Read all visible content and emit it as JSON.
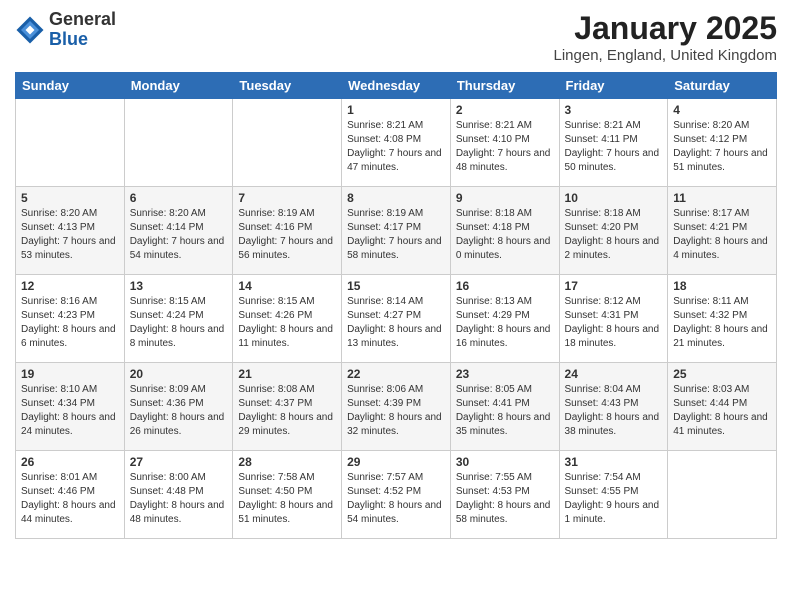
{
  "header": {
    "logo_general": "General",
    "logo_blue": "Blue",
    "month_title": "January 2025",
    "location": "Lingen, England, United Kingdom"
  },
  "weekdays": [
    "Sunday",
    "Monday",
    "Tuesday",
    "Wednesday",
    "Thursday",
    "Friday",
    "Saturday"
  ],
  "weeks": [
    [
      {
        "day": "",
        "sunrise": "",
        "sunset": "",
        "daylight": ""
      },
      {
        "day": "",
        "sunrise": "",
        "sunset": "",
        "daylight": ""
      },
      {
        "day": "",
        "sunrise": "",
        "sunset": "",
        "daylight": ""
      },
      {
        "day": "1",
        "sunrise": "Sunrise: 8:21 AM",
        "sunset": "Sunset: 4:08 PM",
        "daylight": "Daylight: 7 hours and 47 minutes."
      },
      {
        "day": "2",
        "sunrise": "Sunrise: 8:21 AM",
        "sunset": "Sunset: 4:10 PM",
        "daylight": "Daylight: 7 hours and 48 minutes."
      },
      {
        "day": "3",
        "sunrise": "Sunrise: 8:21 AM",
        "sunset": "Sunset: 4:11 PM",
        "daylight": "Daylight: 7 hours and 50 minutes."
      },
      {
        "day": "4",
        "sunrise": "Sunrise: 8:20 AM",
        "sunset": "Sunset: 4:12 PM",
        "daylight": "Daylight: 7 hours and 51 minutes."
      }
    ],
    [
      {
        "day": "5",
        "sunrise": "Sunrise: 8:20 AM",
        "sunset": "Sunset: 4:13 PM",
        "daylight": "Daylight: 7 hours and 53 minutes."
      },
      {
        "day": "6",
        "sunrise": "Sunrise: 8:20 AM",
        "sunset": "Sunset: 4:14 PM",
        "daylight": "Daylight: 7 hours and 54 minutes."
      },
      {
        "day": "7",
        "sunrise": "Sunrise: 8:19 AM",
        "sunset": "Sunset: 4:16 PM",
        "daylight": "Daylight: 7 hours and 56 minutes."
      },
      {
        "day": "8",
        "sunrise": "Sunrise: 8:19 AM",
        "sunset": "Sunset: 4:17 PM",
        "daylight": "Daylight: 7 hours and 58 minutes."
      },
      {
        "day": "9",
        "sunrise": "Sunrise: 8:18 AM",
        "sunset": "Sunset: 4:18 PM",
        "daylight": "Daylight: 8 hours and 0 minutes."
      },
      {
        "day": "10",
        "sunrise": "Sunrise: 8:18 AM",
        "sunset": "Sunset: 4:20 PM",
        "daylight": "Daylight: 8 hours and 2 minutes."
      },
      {
        "day": "11",
        "sunrise": "Sunrise: 8:17 AM",
        "sunset": "Sunset: 4:21 PM",
        "daylight": "Daylight: 8 hours and 4 minutes."
      }
    ],
    [
      {
        "day": "12",
        "sunrise": "Sunrise: 8:16 AM",
        "sunset": "Sunset: 4:23 PM",
        "daylight": "Daylight: 8 hours and 6 minutes."
      },
      {
        "day": "13",
        "sunrise": "Sunrise: 8:15 AM",
        "sunset": "Sunset: 4:24 PM",
        "daylight": "Daylight: 8 hours and 8 minutes."
      },
      {
        "day": "14",
        "sunrise": "Sunrise: 8:15 AM",
        "sunset": "Sunset: 4:26 PM",
        "daylight": "Daylight: 8 hours and 11 minutes."
      },
      {
        "day": "15",
        "sunrise": "Sunrise: 8:14 AM",
        "sunset": "Sunset: 4:27 PM",
        "daylight": "Daylight: 8 hours and 13 minutes."
      },
      {
        "day": "16",
        "sunrise": "Sunrise: 8:13 AM",
        "sunset": "Sunset: 4:29 PM",
        "daylight": "Daylight: 8 hours and 16 minutes."
      },
      {
        "day": "17",
        "sunrise": "Sunrise: 8:12 AM",
        "sunset": "Sunset: 4:31 PM",
        "daylight": "Daylight: 8 hours and 18 minutes."
      },
      {
        "day": "18",
        "sunrise": "Sunrise: 8:11 AM",
        "sunset": "Sunset: 4:32 PM",
        "daylight": "Daylight: 8 hours and 21 minutes."
      }
    ],
    [
      {
        "day": "19",
        "sunrise": "Sunrise: 8:10 AM",
        "sunset": "Sunset: 4:34 PM",
        "daylight": "Daylight: 8 hours and 24 minutes."
      },
      {
        "day": "20",
        "sunrise": "Sunrise: 8:09 AM",
        "sunset": "Sunset: 4:36 PM",
        "daylight": "Daylight: 8 hours and 26 minutes."
      },
      {
        "day": "21",
        "sunrise": "Sunrise: 8:08 AM",
        "sunset": "Sunset: 4:37 PM",
        "daylight": "Daylight: 8 hours and 29 minutes."
      },
      {
        "day": "22",
        "sunrise": "Sunrise: 8:06 AM",
        "sunset": "Sunset: 4:39 PM",
        "daylight": "Daylight: 8 hours and 32 minutes."
      },
      {
        "day": "23",
        "sunrise": "Sunrise: 8:05 AM",
        "sunset": "Sunset: 4:41 PM",
        "daylight": "Daylight: 8 hours and 35 minutes."
      },
      {
        "day": "24",
        "sunrise": "Sunrise: 8:04 AM",
        "sunset": "Sunset: 4:43 PM",
        "daylight": "Daylight: 8 hours and 38 minutes."
      },
      {
        "day": "25",
        "sunrise": "Sunrise: 8:03 AM",
        "sunset": "Sunset: 4:44 PM",
        "daylight": "Daylight: 8 hours and 41 minutes."
      }
    ],
    [
      {
        "day": "26",
        "sunrise": "Sunrise: 8:01 AM",
        "sunset": "Sunset: 4:46 PM",
        "daylight": "Daylight: 8 hours and 44 minutes."
      },
      {
        "day": "27",
        "sunrise": "Sunrise: 8:00 AM",
        "sunset": "Sunset: 4:48 PM",
        "daylight": "Daylight: 8 hours and 48 minutes."
      },
      {
        "day": "28",
        "sunrise": "Sunrise: 7:58 AM",
        "sunset": "Sunset: 4:50 PM",
        "daylight": "Daylight: 8 hours and 51 minutes."
      },
      {
        "day": "29",
        "sunrise": "Sunrise: 7:57 AM",
        "sunset": "Sunset: 4:52 PM",
        "daylight": "Daylight: 8 hours and 54 minutes."
      },
      {
        "day": "30",
        "sunrise": "Sunrise: 7:55 AM",
        "sunset": "Sunset: 4:53 PM",
        "daylight": "Daylight: 8 hours and 58 minutes."
      },
      {
        "day": "31",
        "sunrise": "Sunrise: 7:54 AM",
        "sunset": "Sunset: 4:55 PM",
        "daylight": "Daylight: 9 hours and 1 minute."
      },
      {
        "day": "",
        "sunrise": "",
        "sunset": "",
        "daylight": ""
      }
    ]
  ]
}
